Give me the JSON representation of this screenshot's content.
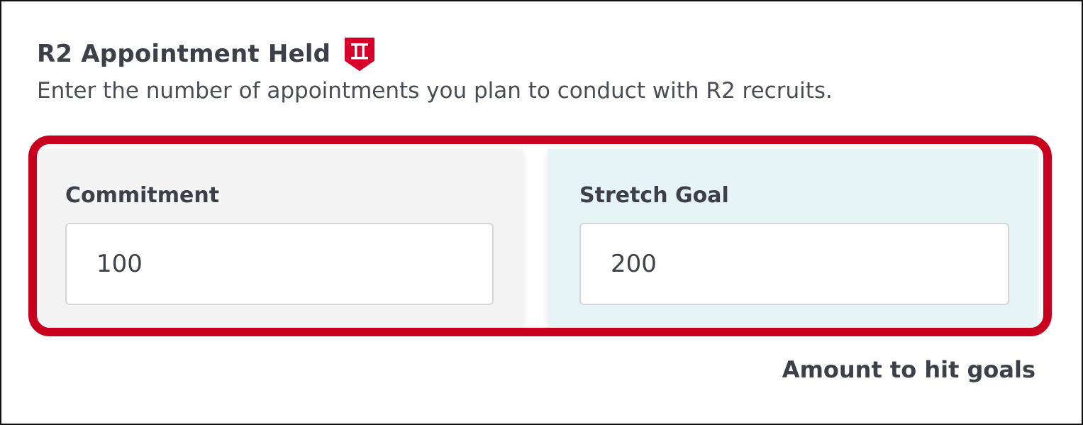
{
  "header": {
    "title": "R2 Appointment Held",
    "badge_icon": "shield-roman-two-icon",
    "badge_color": "#d8002a",
    "subtitle": "Enter the number of appointments you plan to conduct with R2 recruits."
  },
  "goals": {
    "commitment": {
      "label": "Commitment",
      "value": "100",
      "background": "#f4f4f4"
    },
    "stretch": {
      "label": "Stretch Goal",
      "value": "200",
      "background": "#e6f4f6"
    }
  },
  "highlight_color": "#c8001e",
  "footer": {
    "note": "Amount to hit goals"
  }
}
